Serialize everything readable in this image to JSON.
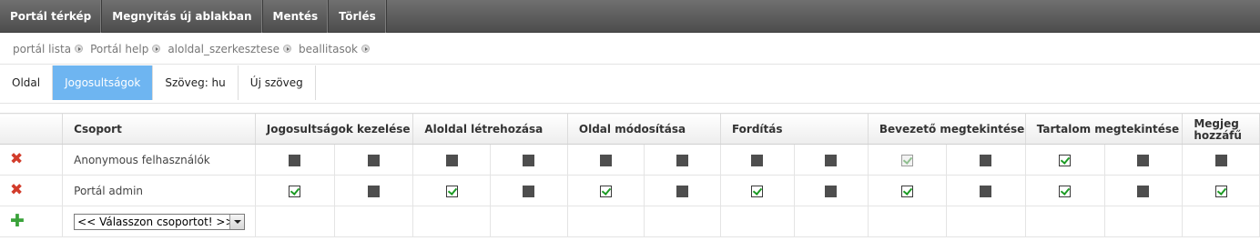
{
  "toolbar": {
    "buttons": [
      "Portál térkép",
      "Megnyitás új ablakban",
      "Mentés",
      "Törlés"
    ]
  },
  "breadcrumb": [
    "portál lista",
    "Portál help",
    "aloldal_szerkesztese",
    "beallitasok"
  ],
  "tabs": [
    {
      "label": "Oldal",
      "active": false
    },
    {
      "label": "Jogosultságok",
      "active": true
    },
    {
      "label": "Szöveg: hu",
      "active": false
    },
    {
      "label": "Új szöveg",
      "active": false
    }
  ],
  "table": {
    "headers": {
      "group": "Csoport",
      "perms": [
        "Jogosultságok kezelése",
        "Aloldal létrehozása",
        "Oldal módosítása",
        "Fordítás",
        "Bevezető megtekintése",
        "Tartalom megtekintése",
        "Megjeg\nhozzáfű"
      ]
    },
    "rows": [
      {
        "name": "Anonymous felhasználók",
        "icon": "delete-icon",
        "checks": [
          "off",
          "off",
          "off",
          "off",
          "off",
          "off",
          "off",
          "off",
          "disabled-on",
          "off",
          "on",
          "off",
          "off"
        ]
      },
      {
        "name": "Portál admin",
        "icon": "delete-icon",
        "checks": [
          "on",
          "off",
          "on",
          "off",
          "on",
          "off",
          "on",
          "off",
          "on",
          "off",
          "on",
          "off",
          "on"
        ]
      }
    ],
    "add_row": {
      "icon": "add-icon",
      "select_value": "<< Válasszon csoportot! >>"
    }
  },
  "colors": {
    "toolbar_bg": "#5a5a5a",
    "active_tab": "#6eb5f1",
    "delete_icon": "#d23c2b",
    "add_icon": "#3aa23a",
    "check_green": "#1c9b24"
  }
}
